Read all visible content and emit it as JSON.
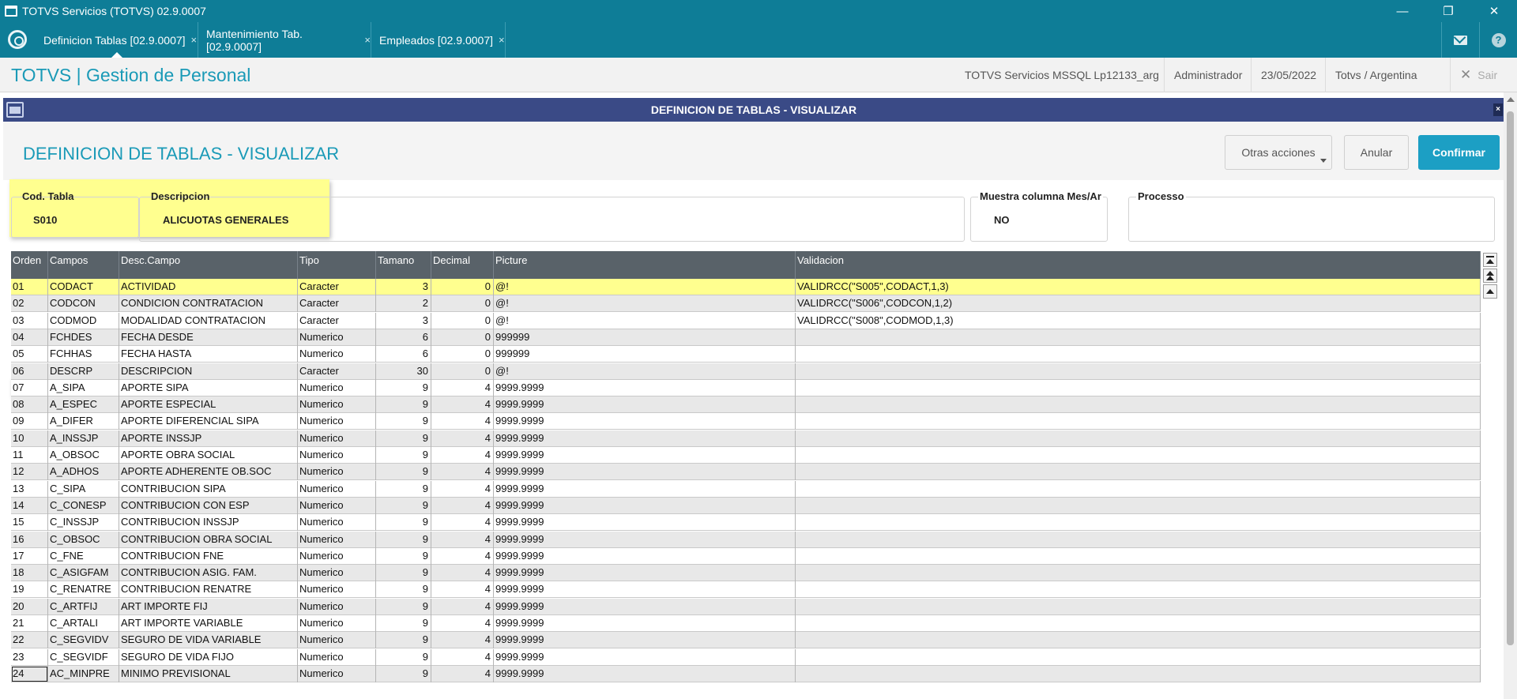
{
  "window": {
    "title": "TOTVS Servicios (TOTVS) 02.9.0007",
    "minimize_glyph": "—",
    "restore_glyph": "❐",
    "close_glyph": "✕"
  },
  "tabs": [
    {
      "label": "Definicion Tablas [02.9.0007]",
      "close": "×"
    },
    {
      "label": "Mantenimiento Tab. [02.9.0007]",
      "close": "×"
    },
    {
      "label": "Empleados [02.9.0007]",
      "close": "×"
    }
  ],
  "tab_icons": {
    "mail": "mail-icon",
    "help": "?"
  },
  "header": {
    "app_title": "TOTVS | Gestion de Personal",
    "environment": "TOTVS Servicios MSSQL Lp12133_arg",
    "user": "Administrador",
    "date": "23/05/2022",
    "company": "Totvs / Argentina",
    "exit_label": "Sair",
    "exit_glyph": "✕"
  },
  "dialog": {
    "window_title": "DEFINICION DE TABLAS - VISUALIZAR",
    "page_title": "DEFINICION DE TABLAS - VISUALIZAR",
    "close_glyph": "×",
    "buttons": {
      "other_actions": "Otras acciones",
      "cancel": "Anular",
      "confirm": "Confirmar"
    }
  },
  "fields": {
    "cod_tabla": {
      "label": "Cod. Tabla",
      "value": "S010"
    },
    "descripcion": {
      "label": "Descripcion",
      "value": "ALICUOTAS GENERALES"
    },
    "muestra": {
      "label": "Muestra columna Mes/Ar",
      "value": "NO"
    },
    "processo": {
      "label": "Processo",
      "value": ""
    }
  },
  "grid": {
    "columns": [
      "Orden",
      "Campos",
      "Desc.Campo",
      "Tipo",
      "Tamano",
      "Decimal",
      "Picture",
      "Validacion"
    ],
    "rows": [
      [
        "01",
        "CODACT",
        "ACTIVIDAD",
        "Caracter",
        "3",
        "0",
        "@!",
        "VALIDRCC(\"S005\",CODACT,1,3)"
      ],
      [
        "02",
        "CODCON",
        "CONDICION CONTRATACION",
        "Caracter",
        "2",
        "0",
        "@!",
        "VALIDRCC(\"S006\",CODCON,1,2)"
      ],
      [
        "03",
        "CODMOD",
        "MODALIDAD CONTRATACION",
        "Caracter",
        "3",
        "0",
        "@!",
        "VALIDRCC(\"S008\",CODMOD,1,3)"
      ],
      [
        "04",
        "FCHDES",
        "FECHA DESDE",
        "Numerico",
        "6",
        "0",
        "999999",
        ""
      ],
      [
        "05",
        "FCHHAS",
        "FECHA HASTA",
        "Numerico",
        "6",
        "0",
        "999999",
        ""
      ],
      [
        "06",
        "DESCRP",
        "DESCRIPCION",
        "Caracter",
        "30",
        "0",
        "@!",
        ""
      ],
      [
        "07",
        "A_SIPA",
        "APORTE SIPA",
        "Numerico",
        "9",
        "4",
        "9999.9999",
        ""
      ],
      [
        "08",
        "A_ESPEC",
        "APORTE ESPECIAL",
        "Numerico",
        "9",
        "4",
        "9999.9999",
        ""
      ],
      [
        "09",
        "A_DIFER",
        "APORTE DIFERENCIAL SIPA",
        "Numerico",
        "9",
        "4",
        "9999.9999",
        ""
      ],
      [
        "10",
        "A_INSSJP",
        "APORTE INSSJP",
        "Numerico",
        "9",
        "4",
        "9999.9999",
        ""
      ],
      [
        "11",
        "A_OBSOC",
        "APORTE OBRA SOCIAL",
        "Numerico",
        "9",
        "4",
        "9999.9999",
        ""
      ],
      [
        "12",
        "A_ADHOS",
        "APORTE ADHERENTE OB.SOC",
        "Numerico",
        "9",
        "4",
        "9999.9999",
        ""
      ],
      [
        "13",
        "C_SIPA",
        "CONTRIBUCION SIPA",
        "Numerico",
        "9",
        "4",
        "9999.9999",
        ""
      ],
      [
        "14",
        "C_CONESP",
        "CONTRIBUCION CON ESP",
        "Numerico",
        "9",
        "4",
        "9999.9999",
        ""
      ],
      [
        "15",
        "C_INSSJP",
        "CONTRIBUCION INSSJP",
        "Numerico",
        "9",
        "4",
        "9999.9999",
        ""
      ],
      [
        "16",
        "C_OBSOC",
        "CONTRIBUCION OBRA SOCIAL",
        "Numerico",
        "9",
        "4",
        "9999.9999",
        ""
      ],
      [
        "17",
        "C_FNE",
        "CONTRIBUCION  FNE",
        "Numerico",
        "9",
        "4",
        "9999.9999",
        ""
      ],
      [
        "18",
        "C_ASIGFAM",
        "CONTRIBUCION ASIG. FAM.",
        "Numerico",
        "9",
        "4",
        "9999.9999",
        ""
      ],
      [
        "19",
        "C_RENATRE",
        "CONTRIBUCION RENATRE",
        "Numerico",
        "9",
        "4",
        "9999.9999",
        ""
      ],
      [
        "20",
        "C_ARTFIJ",
        "ART IMPORTE FIJ",
        "Numerico",
        "9",
        "4",
        "9999.9999",
        ""
      ],
      [
        "21",
        "C_ARTALI",
        "ART IMPORTE VARIABLE",
        "Numerico",
        "9",
        "4",
        "9999.9999",
        ""
      ],
      [
        "22",
        "C_SEGVIDV",
        "SEGURO DE VIDA VARIABLE",
        "Numerico",
        "9",
        "4",
        "9999.9999",
        ""
      ],
      [
        "23",
        "C_SEGVIDF",
        "SEGURO DE VIDA FIJO",
        "Numerico",
        "9",
        "4",
        "9999.9999",
        ""
      ],
      [
        "24",
        "AC_MINPRE",
        "MINIMO PREVISIONAL",
        "Numerico",
        "9",
        "4",
        "9999.9999",
        ""
      ]
    ]
  },
  "colors": {
    "accent": "#0e7d97",
    "title_text": "#1a9ab7",
    "dialog_title_bar": "#3a4a86",
    "grid_header": "#596269",
    "highlight": "#ffff8f",
    "primary_button": "#1c9fc4"
  }
}
